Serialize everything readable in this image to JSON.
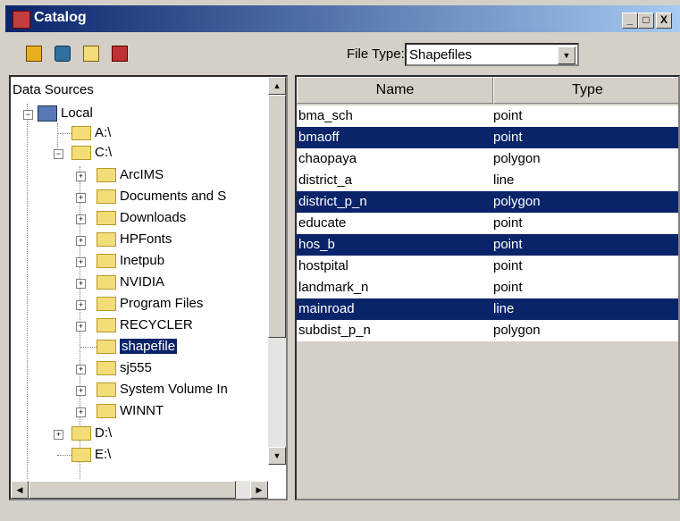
{
  "window": {
    "title": "Catalog",
    "min": "_",
    "max": "□",
    "close": "X"
  },
  "toolbar": {
    "file_type_label": "File Type:",
    "file_type_value": "Shapefiles"
  },
  "tree": {
    "root": "Data Sources",
    "local": "Local",
    "a": "A:\\",
    "c": "C:\\",
    "c_children": [
      "ArcIMS",
      "Documents and S",
      "Downloads",
      "HPFonts",
      "Inetpub",
      "NVIDIA",
      "Program Files",
      "RECYCLER",
      "shapefile",
      "sj555",
      "System Volume In",
      "WINNT"
    ],
    "d": "D:\\",
    "e": "E:\\"
  },
  "list": {
    "columns": [
      "Name",
      "Type"
    ],
    "rows": [
      {
        "name": "bma_sch",
        "type": "point",
        "selected": false
      },
      {
        "name": "bmaoff",
        "type": "point",
        "selected": true
      },
      {
        "name": "chaopaya",
        "type": "polygon",
        "selected": false
      },
      {
        "name": "district_a",
        "type": "line",
        "selected": false
      },
      {
        "name": "district_p_n",
        "type": "polygon",
        "selected": true
      },
      {
        "name": "educate",
        "type": "point",
        "selected": false
      },
      {
        "name": "hos_b",
        "type": "point",
        "selected": true
      },
      {
        "name": "hostpital",
        "type": "point",
        "selected": false
      },
      {
        "name": "landmark_n",
        "type": "point",
        "selected": false
      },
      {
        "name": "mainroad",
        "type": "line",
        "selected": true
      },
      {
        "name": "subdist_p_n",
        "type": "polygon",
        "selected": false
      }
    ]
  },
  "colors": {
    "selection": "#0a246a",
    "titlebar": "#0a246a",
    "face": "#d4d0c8"
  }
}
